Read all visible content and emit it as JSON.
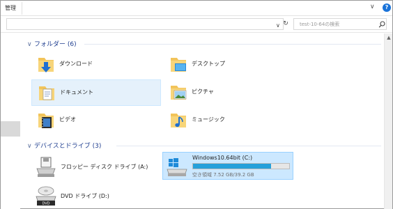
{
  "ribbon": {
    "tab_label": "管理"
  },
  "search": {
    "placeholder": "test-10-64の検索"
  },
  "groups": {
    "folders": {
      "label": "フォルダー (6)"
    },
    "devices": {
      "label": "デバイスとドライブ (3)"
    }
  },
  "folders": [
    {
      "label": "ダウンロード",
      "icon": "download-folder-icon"
    },
    {
      "label": "デスクトップ",
      "icon": "desktop-folder-icon"
    },
    {
      "label": "ドキュメント",
      "icon": "documents-folder-icon"
    },
    {
      "label": "ピクチャ",
      "icon": "pictures-folder-icon"
    },
    {
      "label": "ビデオ",
      "icon": "videos-folder-icon"
    },
    {
      "label": "ミュージック",
      "icon": "music-folder-icon"
    }
  ],
  "drives": [
    {
      "label": "フロッピー ディスク ドライブ (A:)",
      "icon": "floppy-drive-icon"
    },
    {
      "label": "Windows10.64bit (C:)",
      "icon": "windows-drive-icon",
      "free_space": "空き領域 7.52 GB/39.2 GB",
      "used_fraction": 0.81
    },
    {
      "label": "DVD ドライブ (D:)",
      "icon": "dvd-drive-icon"
    }
  ],
  "colors": {
    "accent": "#1e3d8f",
    "selection": "#e5f1fb",
    "drive_selection": "#cce8ff",
    "usage_bar": "#26a0da",
    "folder": "#f2c45a"
  }
}
